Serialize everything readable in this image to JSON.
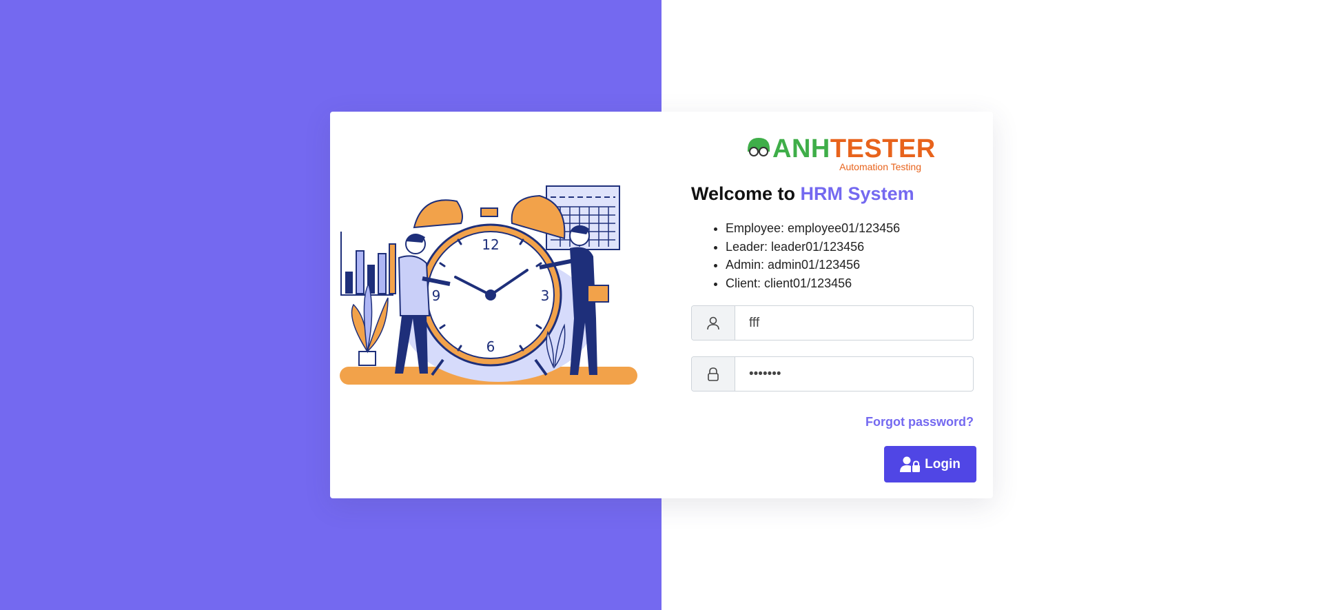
{
  "brand": {
    "name_green": "ANH",
    "name_orange": "TESTER",
    "tagline": "Automation Testing",
    "colors": {
      "green": "#3fae49",
      "orange": "#e8631c"
    }
  },
  "welcome": {
    "prefix": "Welcome to ",
    "highlight": "HRM System"
  },
  "credentials": [
    "Employee: employee01/123456",
    "Leader: leader01/123456",
    "Admin: admin01/123456",
    "Client: client01/123456"
  ],
  "username": {
    "value": "fff",
    "icon": "user-icon"
  },
  "password": {
    "value": "1234567",
    "icon": "lock-icon"
  },
  "forgot_label": "Forgot password?",
  "login_label": "Login",
  "colors": {
    "accent": "#7469f0",
    "button": "#5046e5",
    "left_bg": "#7469f0"
  }
}
